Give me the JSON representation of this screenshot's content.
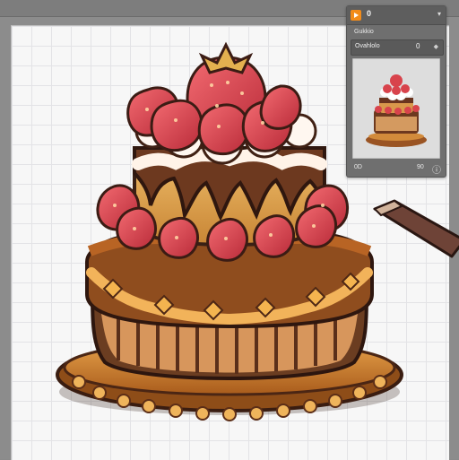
{
  "panel": {
    "badge": "0",
    "subtitle": "Gukkio",
    "row_label": "Ovahlolo",
    "row_value": "0",
    "footer_left": "0D",
    "footer_right": "90"
  },
  "icons": {
    "play": "play-icon",
    "caret": "chevron-down-icon",
    "row_icon": "diamond-icon",
    "footer_icon": "info-icon",
    "pencil": "pencil-icon"
  },
  "colors": {
    "accent": "#f28c1a",
    "canvas": "#f7f7f7",
    "grid": "#e3e3e6",
    "cake_brown": "#6b3d21",
    "cake_gold": "#c97a2b",
    "strawberry": "#d83f4a",
    "cream": "#fff3e8"
  }
}
